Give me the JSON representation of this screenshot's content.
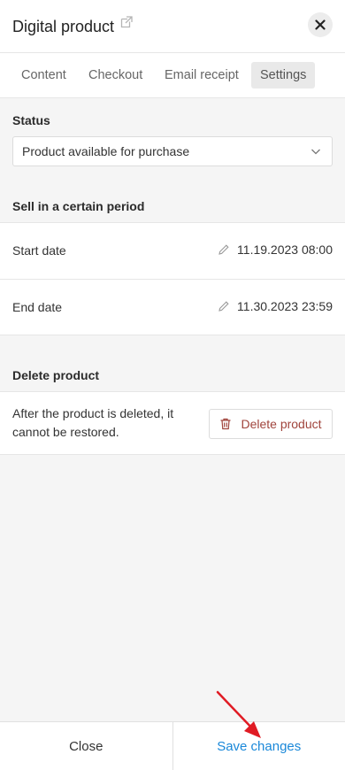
{
  "header": {
    "title": "Digital product",
    "external_icon": "external-link-icon",
    "close_icon": "close-icon"
  },
  "tabs": [
    {
      "label": "Content"
    },
    {
      "label": "Checkout"
    },
    {
      "label": "Email receipt"
    },
    {
      "label": "Settings",
      "active": true
    }
  ],
  "status": {
    "heading": "Status",
    "selected": "Product available for purchase"
  },
  "period": {
    "heading": "Sell in a certain period",
    "start_label": "Start date",
    "start_value": "11.19.2023 08:00",
    "end_label": "End date",
    "end_value": "11.30.2023 23:59"
  },
  "delete": {
    "heading": "Delete product",
    "description": "After the product is deleted, it cannot be restored.",
    "button_label": "Delete product"
  },
  "footer": {
    "close_label": "Close",
    "save_label": "Save changes"
  },
  "colors": {
    "accent": "#1a88d9",
    "danger": "#a0443c",
    "annotation_arrow": "#e01b24"
  }
}
